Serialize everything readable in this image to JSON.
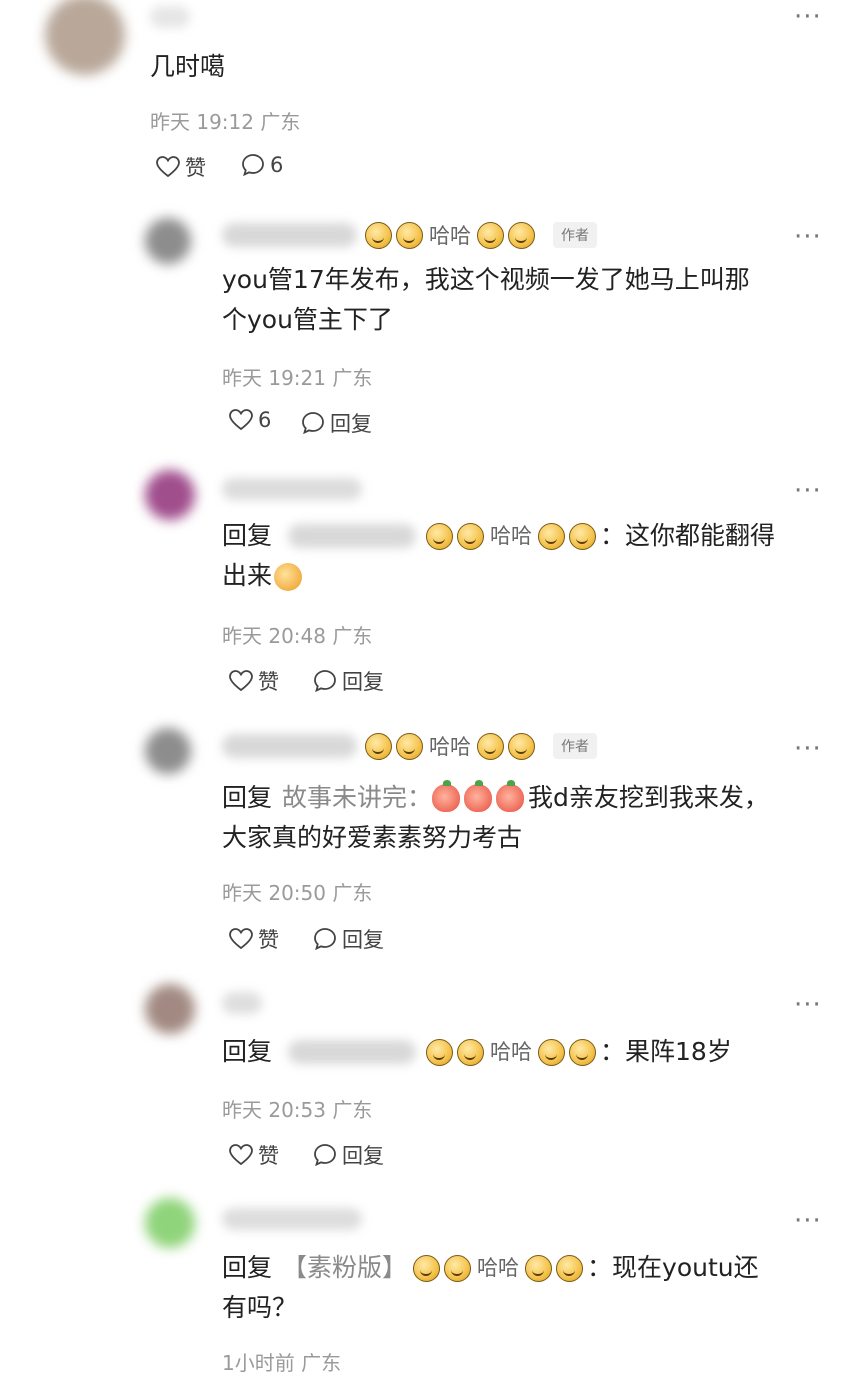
{
  "colors": {
    "text": "#222222",
    "meta": "#9a9a9a",
    "icon": "#444444"
  },
  "top_comment": {
    "text": "几时噶",
    "time": "昨天 19:12",
    "location": "广东",
    "like_label": "赞",
    "comment_count": "6"
  },
  "replies": [
    {
      "haha": "哈哈",
      "author_tag": "作者",
      "text_line1": "you管17年发布，我这个视频一发了她马上叫那",
      "text_line2": "个you管主下了",
      "time": "昨天 19:21",
      "location": "广东",
      "like_label": "6",
      "reply_label": "回复"
    },
    {
      "reply_prefix": "回复",
      "haha": "哈哈",
      "text_line1": "：这你都能翻得",
      "text_line2": "出来",
      "time": "昨天 20:48",
      "location": "广东",
      "like_label": "赞",
      "reply_label": "回复"
    },
    {
      "haha": "哈哈",
      "author_tag": "作者",
      "reply_prefix": "回复",
      "reply_to": "故事未讲完：",
      "text_line1": "我d亲友挖到我来发，",
      "text_line2": "大家真的好爱素素努力考古",
      "time": "昨天 20:50",
      "location": "广东",
      "like_label": "赞",
      "reply_label": "回复"
    },
    {
      "reply_prefix": "回复",
      "haha": "哈哈",
      "text_line1": "：果阵18岁",
      "time": "昨天 20:53",
      "location": "广东",
      "like_label": "赞",
      "reply_label": "回复"
    },
    {
      "reply_prefix": "回复",
      "reply_to": "【素粉版】",
      "haha": "哈哈",
      "text_line1": "：现在youtu还",
      "text_line2": "有吗？",
      "time": "1小时前",
      "location": "广东"
    }
  ]
}
